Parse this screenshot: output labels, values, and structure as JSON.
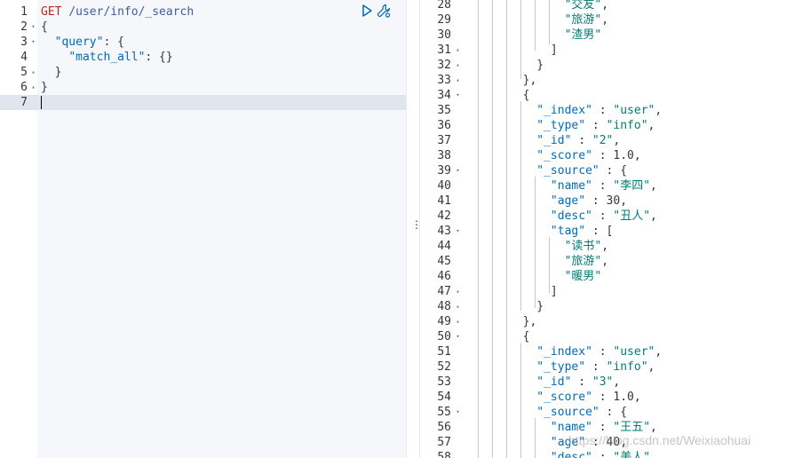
{
  "request": {
    "lines": [
      {
        "n": "1",
        "fold": "",
        "code": [
          {
            "t": "method",
            "v": "GET"
          },
          {
            "t": "punc",
            "v": " "
          },
          {
            "t": "url",
            "v": "/user/info/_search"
          }
        ]
      },
      {
        "n": "2",
        "fold": "▾",
        "code": [
          {
            "t": "punc",
            "v": "{"
          }
        ]
      },
      {
        "n": "3",
        "fold": "▾",
        "code": [
          {
            "t": "punc",
            "v": "  "
          },
          {
            "t": "key",
            "v": "\"query\""
          },
          {
            "t": "punc",
            "v": ": {"
          }
        ]
      },
      {
        "n": "4",
        "fold": "",
        "code": [
          {
            "t": "punc",
            "v": "    "
          },
          {
            "t": "key",
            "v": "\"match_all\""
          },
          {
            "t": "punc",
            "v": ": {}"
          }
        ]
      },
      {
        "n": "5",
        "fold": "▴",
        "code": [
          {
            "t": "punc",
            "v": "  }"
          }
        ]
      },
      {
        "n": "6",
        "fold": "▴",
        "code": [
          {
            "t": "punc",
            "v": "}"
          }
        ]
      },
      {
        "n": "7",
        "fold": "",
        "code": [],
        "active": true
      }
    ],
    "actions": [
      {
        "name": "run-request-icon",
        "title": "Click to send request"
      },
      {
        "name": "wrench-icon",
        "title": "Settings"
      }
    ]
  },
  "response": {
    "lines": [
      {
        "n": "28",
        "fold": "",
        "code": [
          {
            "t": "punc",
            "v": "              "
          },
          {
            "t": "str",
            "v": "\"交友\""
          },
          {
            "t": "punc",
            "v": ","
          }
        ]
      },
      {
        "n": "29",
        "fold": "",
        "code": [
          {
            "t": "punc",
            "v": "              "
          },
          {
            "t": "str",
            "v": "\"旅游\""
          },
          {
            "t": "punc",
            "v": ","
          }
        ]
      },
      {
        "n": "30",
        "fold": "",
        "code": [
          {
            "t": "punc",
            "v": "              "
          },
          {
            "t": "str",
            "v": "\"渣男\""
          }
        ]
      },
      {
        "n": "31",
        "fold": "▴",
        "code": [
          {
            "t": "punc",
            "v": "            ]"
          }
        ]
      },
      {
        "n": "32",
        "fold": "▴",
        "code": [
          {
            "t": "punc",
            "v": "          }"
          }
        ]
      },
      {
        "n": "33",
        "fold": "▴",
        "code": [
          {
            "t": "punc",
            "v": "        },"
          }
        ]
      },
      {
        "n": "34",
        "fold": "▾",
        "code": [
          {
            "t": "punc",
            "v": "        {"
          }
        ]
      },
      {
        "n": "35",
        "fold": "",
        "code": [
          {
            "t": "punc",
            "v": "          "
          },
          {
            "t": "key",
            "v": "\"_index\""
          },
          {
            "t": "punc",
            "v": " : "
          },
          {
            "t": "str",
            "v": "\"user\""
          },
          {
            "t": "punc",
            "v": ","
          }
        ]
      },
      {
        "n": "36",
        "fold": "",
        "code": [
          {
            "t": "punc",
            "v": "          "
          },
          {
            "t": "key",
            "v": "\"_type\""
          },
          {
            "t": "punc",
            "v": " : "
          },
          {
            "t": "str",
            "v": "\"info\""
          },
          {
            "t": "punc",
            "v": ","
          }
        ]
      },
      {
        "n": "37",
        "fold": "",
        "code": [
          {
            "t": "punc",
            "v": "          "
          },
          {
            "t": "key",
            "v": "\"_id\""
          },
          {
            "t": "punc",
            "v": " : "
          },
          {
            "t": "str",
            "v": "\"2\""
          },
          {
            "t": "punc",
            "v": ","
          }
        ]
      },
      {
        "n": "38",
        "fold": "",
        "code": [
          {
            "t": "punc",
            "v": "          "
          },
          {
            "t": "key",
            "v": "\"_score\""
          },
          {
            "t": "punc",
            "v": " : "
          },
          {
            "t": "num",
            "v": "1.0"
          },
          {
            "t": "punc",
            "v": ","
          }
        ]
      },
      {
        "n": "39",
        "fold": "▾",
        "code": [
          {
            "t": "punc",
            "v": "          "
          },
          {
            "t": "key",
            "v": "\"_source\""
          },
          {
            "t": "punc",
            "v": " : {"
          }
        ]
      },
      {
        "n": "40",
        "fold": "",
        "code": [
          {
            "t": "punc",
            "v": "            "
          },
          {
            "t": "key",
            "v": "\"name\""
          },
          {
            "t": "punc",
            "v": " : "
          },
          {
            "t": "str",
            "v": "\"李四\""
          },
          {
            "t": "punc",
            "v": ","
          }
        ]
      },
      {
        "n": "41",
        "fold": "",
        "code": [
          {
            "t": "punc",
            "v": "            "
          },
          {
            "t": "key",
            "v": "\"age\""
          },
          {
            "t": "punc",
            "v": " : "
          },
          {
            "t": "num",
            "v": "30"
          },
          {
            "t": "punc",
            "v": ","
          }
        ]
      },
      {
        "n": "42",
        "fold": "",
        "code": [
          {
            "t": "punc",
            "v": "            "
          },
          {
            "t": "key",
            "v": "\"desc\""
          },
          {
            "t": "punc",
            "v": " : "
          },
          {
            "t": "str",
            "v": "\"丑人\""
          },
          {
            "t": "punc",
            "v": ","
          }
        ]
      },
      {
        "n": "43",
        "fold": "▾",
        "code": [
          {
            "t": "punc",
            "v": "            "
          },
          {
            "t": "key",
            "v": "\"tag\""
          },
          {
            "t": "punc",
            "v": " : ["
          }
        ]
      },
      {
        "n": "44",
        "fold": "",
        "code": [
          {
            "t": "punc",
            "v": "              "
          },
          {
            "t": "str",
            "v": "\"读书\""
          },
          {
            "t": "punc",
            "v": ","
          }
        ]
      },
      {
        "n": "45",
        "fold": "",
        "code": [
          {
            "t": "punc",
            "v": "              "
          },
          {
            "t": "str",
            "v": "\"旅游\""
          },
          {
            "t": "punc",
            "v": ","
          }
        ]
      },
      {
        "n": "46",
        "fold": "",
        "code": [
          {
            "t": "punc",
            "v": "              "
          },
          {
            "t": "str",
            "v": "\"暖男\""
          }
        ]
      },
      {
        "n": "47",
        "fold": "▴",
        "code": [
          {
            "t": "punc",
            "v": "            ]"
          }
        ]
      },
      {
        "n": "48",
        "fold": "▴",
        "code": [
          {
            "t": "punc",
            "v": "          }"
          }
        ]
      },
      {
        "n": "49",
        "fold": "▴",
        "code": [
          {
            "t": "punc",
            "v": "        },"
          }
        ]
      },
      {
        "n": "50",
        "fold": "▾",
        "code": [
          {
            "t": "punc",
            "v": "        {"
          }
        ]
      },
      {
        "n": "51",
        "fold": "",
        "code": [
          {
            "t": "punc",
            "v": "          "
          },
          {
            "t": "key",
            "v": "\"_index\""
          },
          {
            "t": "punc",
            "v": " : "
          },
          {
            "t": "str",
            "v": "\"user\""
          },
          {
            "t": "punc",
            "v": ","
          }
        ]
      },
      {
        "n": "52",
        "fold": "",
        "code": [
          {
            "t": "punc",
            "v": "          "
          },
          {
            "t": "key",
            "v": "\"_type\""
          },
          {
            "t": "punc",
            "v": " : "
          },
          {
            "t": "str",
            "v": "\"info\""
          },
          {
            "t": "punc",
            "v": ","
          }
        ]
      },
      {
        "n": "53",
        "fold": "",
        "code": [
          {
            "t": "punc",
            "v": "          "
          },
          {
            "t": "key",
            "v": "\"_id\""
          },
          {
            "t": "punc",
            "v": " : "
          },
          {
            "t": "str",
            "v": "\"3\""
          },
          {
            "t": "punc",
            "v": ","
          }
        ]
      },
      {
        "n": "54",
        "fold": "",
        "code": [
          {
            "t": "punc",
            "v": "          "
          },
          {
            "t": "key",
            "v": "\"_score\""
          },
          {
            "t": "punc",
            "v": " : "
          },
          {
            "t": "num",
            "v": "1.0"
          },
          {
            "t": "punc",
            "v": ","
          }
        ]
      },
      {
        "n": "55",
        "fold": "▾",
        "code": [
          {
            "t": "punc",
            "v": "          "
          },
          {
            "t": "key",
            "v": "\"_source\""
          },
          {
            "t": "punc",
            "v": " : {"
          }
        ]
      },
      {
        "n": "56",
        "fold": "",
        "code": [
          {
            "t": "punc",
            "v": "            "
          },
          {
            "t": "key",
            "v": "\"name\""
          },
          {
            "t": "punc",
            "v": " : "
          },
          {
            "t": "str",
            "v": "\"王五\""
          },
          {
            "t": "punc",
            "v": ","
          }
        ]
      },
      {
        "n": "57",
        "fold": "",
        "code": [
          {
            "t": "punc",
            "v": "            "
          },
          {
            "t": "key",
            "v": "\"age\""
          },
          {
            "t": "punc",
            "v": " : "
          },
          {
            "t": "num",
            "v": "40"
          },
          {
            "t": "punc",
            "v": ","
          }
        ]
      },
      {
        "n": "58",
        "fold": "",
        "code": [
          {
            "t": "punc",
            "v": "            "
          },
          {
            "t": "key",
            "v": "\"desc\""
          },
          {
            "t": "punc",
            "v": " : "
          },
          {
            "t": "str",
            "v": "\"美人\""
          },
          {
            "t": "punc",
            "v": ","
          }
        ]
      }
    ]
  },
  "watermark": "https://blog.csdn.net/Weixiaohuai",
  "colors": {
    "method": "#bd271e",
    "url": "#3f5d9e",
    "key": "#006bb8",
    "string": "#017d73",
    "active_line": "#e0e5ee",
    "action_icon": "#006bb8"
  }
}
